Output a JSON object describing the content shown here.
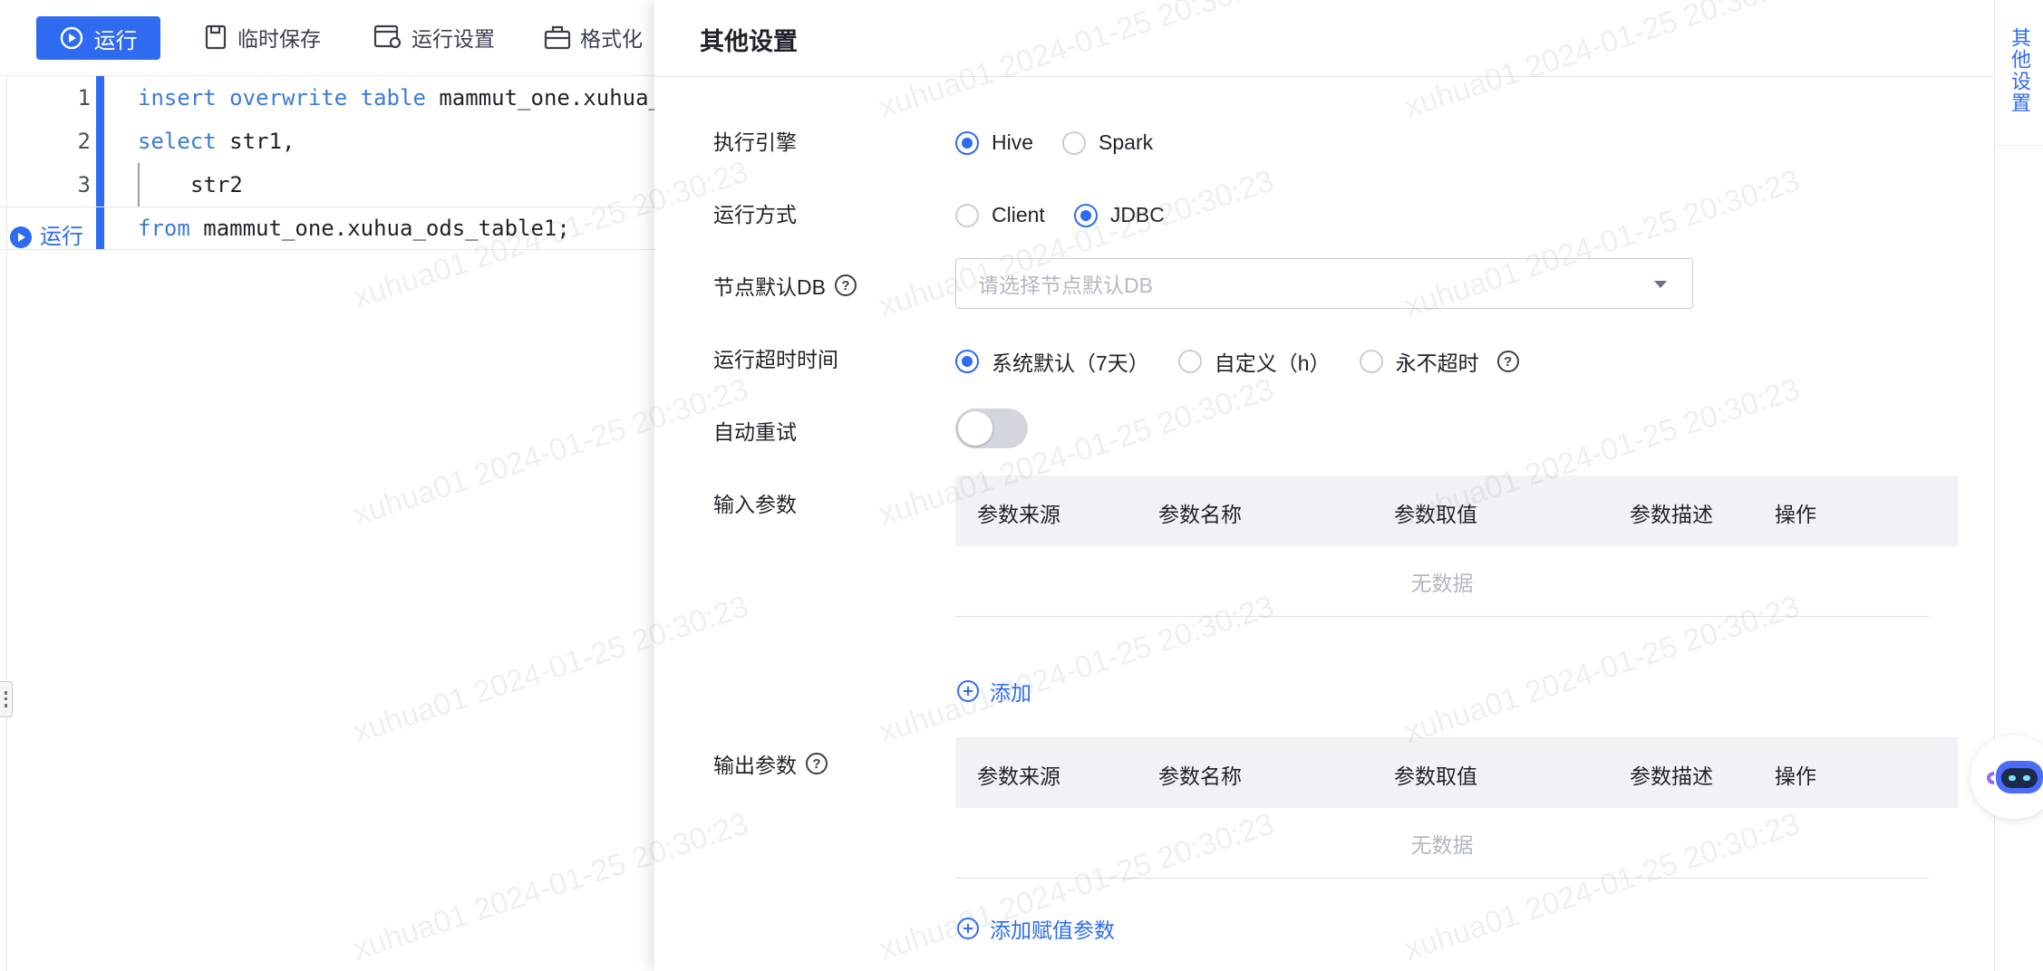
{
  "toolbar": {
    "run_label": "运行",
    "temp_save_label": "临时保存",
    "run_settings_label": "运行设置",
    "format_label": "格式化"
  },
  "editor": {
    "lines": [
      {
        "no": "1",
        "text": "mammut_one.xuhua_"
      },
      {
        "no": "2",
        "text": "str1,"
      },
      {
        "no": "3",
        "text": "str2"
      },
      {
        "no": "",
        "text": "mammut_one.xuhua_ods_table1;"
      }
    ],
    "keywords": {
      "insert": "insert",
      "overwrite": "overwrite",
      "table": "table",
      "select": "select",
      "from": "from"
    },
    "inline_run_label": "运行"
  },
  "drawer": {
    "title": "其他设置",
    "engine": {
      "label": "执行引擎",
      "options": [
        "Hive",
        "Spark"
      ],
      "selected": "Hive"
    },
    "run_mode": {
      "label": "运行方式",
      "options": [
        "Client",
        "JDBC"
      ],
      "selected": "JDBC"
    },
    "default_db": {
      "label": "节点默认DB",
      "placeholder": "请选择节点默认DB"
    },
    "timeout": {
      "label": "运行超时时间",
      "options": [
        "系统默认（7天）",
        "自定义（h）",
        "永不超时"
      ],
      "selected": "系统默认（7天）"
    },
    "auto_retry": {
      "label": "自动重试",
      "enabled": false
    },
    "input_params": {
      "label": "输入参数",
      "columns": [
        "参数来源",
        "参数名称",
        "参数取值",
        "参数描述",
        "操作"
      ],
      "empty_text": "无数据",
      "add_label": "添加"
    },
    "output_params": {
      "label": "输出参数",
      "columns": [
        "参数来源",
        "参数名称",
        "参数取值",
        "参数描述",
        "操作"
      ],
      "empty_text": "无数据",
      "add_label": "添加赋值参数"
    }
  },
  "rail": {
    "tab_label": "其他设置"
  },
  "watermark": "xuhua01 2024-01-25 20:30:23",
  "colors": {
    "accent": "#2f6bf0",
    "keyword": "#3b7bd8",
    "header_bg": "#f0f2f5"
  }
}
